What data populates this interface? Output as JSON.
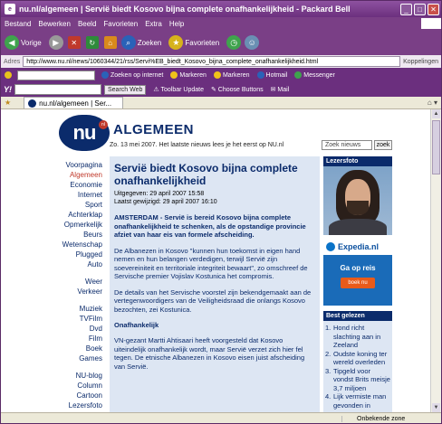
{
  "window": {
    "title": "nu.nl/algemeen | Servië biedt Kosovo bijna complete onafhankelijkheid - Packard Bell"
  },
  "menubar": [
    "Bestand",
    "Bewerken",
    "Beeld",
    "Favorieten",
    "Extra",
    "Help"
  ],
  "navbar": {
    "back_label": "Vorige",
    "search_label": "Zoeken",
    "favorites_label": "Favorieten"
  },
  "address": {
    "label": "Adres",
    "url": "http://www.nu.nl/news/1060344/21/rss/Servi%EB_biedt_Kosovo_bijna_complete_onafhankelijkheid.html",
    "links_label": "Koppelingen"
  },
  "toolbar2": {
    "search_internet": "Zoeken op internet",
    "mark1": "Markeren",
    "mark2": "Markeren",
    "hotmail": "Hotmail",
    "messenger": "Messenger"
  },
  "toolbar3": {
    "logo": "Y!",
    "search_btn": "Search Web",
    "toolbar_update": "Toolbar Update",
    "choose_buttons": "Choose Buttons",
    "mail": "Mail"
  },
  "tab": {
    "label": "nu.nl/algemeen | Ser..."
  },
  "status": {
    "zone": "Onbekende zone"
  },
  "page": {
    "logo_text": "nu",
    "section": "ALGEMEEN",
    "dateline": "Zo. 13 mei 2007. Het laatste nieuws lees je het eerst op NU.nl",
    "search_field": "Zoek nieuws",
    "search_button": "zoek"
  },
  "leftnav": {
    "group1": [
      "Voorpagina",
      "Algemeen",
      "Economie",
      "Internet",
      "Sport",
      "Achterklap",
      "Opmerkelijk",
      "Beurs",
      "Wetenschap",
      "Plugged",
      "Auto"
    ],
    "group2": [
      "Weer",
      "Verkeer"
    ],
    "group3": [
      "Muziek",
      "TVFilm",
      "Dvd",
      "Film",
      "Boek",
      "Games"
    ],
    "group4": [
      "NU-blog",
      "Column",
      "Cartoon",
      "Lezersfoto"
    ]
  },
  "article": {
    "title": "Servië biedt Kosovo bijna complete onafhankelijkheid",
    "published": "Uitgegeven: 29 april 2007 15:58",
    "modified": "Laatst gewijzigd: 29 april 2007 16:10",
    "lead": "AMSTERDAM - Servië is bereid Kosovo bijna complete onafhankelijkheid te schenken, als de opstandige provincie afziet van haar eis van formele afscheiding.",
    "p1": "De Albanezen in Kosovo \"kunnen hun toekomst in eigen hand nemen en hun belangen verdedigen, terwijl Servië zijn soevereiniteit en territoriale integriteit bewaart\", zo omschreef de Servische premier Vojislav Kostunica het compromis.",
    "p2": "De details van het Servische voorstel zijn bekendgemaakt aan de vertegenwoordigers van de Veiligheidsraad die onlangs Kosovo bezochten, zei Kostunica.",
    "subhead": "Onafhankelijk",
    "p3": "VN-gezant Martti Ahtisaari heeft voorgesteld dat Kosovo uiteindelijk onafhankelijk wordt, maar Servië verzet zich hier fel tegen. De etnische Albanezen in Kosovo eisen juist afscheiding van Servië."
  },
  "rightcol": {
    "photo_title": "Lezersfoto",
    "ad_brand": "Expedia.nl",
    "ad_cta": "Ga op reis",
    "ad_button": "boek nu",
    "best_title": "Best gelezen",
    "best": [
      {
        "n": "1.",
        "text": "Hond richt slachting aan in Zeeland"
      },
      {
        "n": "2.",
        "text": "Oudste koning ter wereld overleden"
      },
      {
        "n": "3.",
        "text": "Tipgeld voor vondst Brits meisje 3,7 miljoen"
      },
      {
        "n": "4.",
        "text": "Lijk vermiste man gevonden in"
      }
    ]
  }
}
